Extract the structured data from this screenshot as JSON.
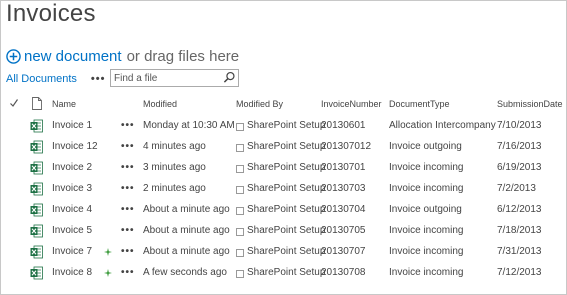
{
  "header": {
    "title": "Invoices"
  },
  "actions": {
    "new_document_label": "new document",
    "or_drag_label": "or drag files here"
  },
  "toolbar": {
    "view_label": "All Documents",
    "more_label": "•••",
    "search_placeholder": "Find a file"
  },
  "columns": [
    "Name",
    "Modified",
    "Modified By",
    "InvoiceNumber",
    "DocumentType",
    "SubmissionDate"
  ],
  "rows": [
    {
      "name": "Invoice 1",
      "is_new": false,
      "modified": "Monday at 10:30 AM",
      "modified_by": "SharePoint Setup",
      "invoice_number": "20130601",
      "document_type": "Allocation Intercompany",
      "submission_date": "7/10/2013"
    },
    {
      "name": "Invoice 12",
      "is_new": false,
      "modified": "4 minutes ago",
      "modified_by": "SharePoint Setup",
      "invoice_number": "201307012",
      "document_type": "Invoice outgoing",
      "submission_date": "7/16/2013"
    },
    {
      "name": "Invoice 2",
      "is_new": false,
      "modified": "3 minutes ago",
      "modified_by": "SharePoint Setup",
      "invoice_number": "20130701",
      "document_type": "Invoice incoming",
      "submission_date": "6/19/2013"
    },
    {
      "name": "Invoice 3",
      "is_new": false,
      "modified": "2 minutes ago",
      "modified_by": "SharePoint Setup",
      "invoice_number": "20130703",
      "document_type": "Invoice incoming",
      "submission_date": "7/2/2013"
    },
    {
      "name": "Invoice 4",
      "is_new": false,
      "modified": "About a minute ago",
      "modified_by": "SharePoint Setup",
      "invoice_number": "20130704",
      "document_type": "Invoice outgoing",
      "submission_date": "6/12/2013"
    },
    {
      "name": "Invoice 5",
      "is_new": false,
      "modified": "About a minute ago",
      "modified_by": "SharePoint Setup",
      "invoice_number": "20130705",
      "document_type": "Invoice incoming",
      "submission_date": "7/18/2013"
    },
    {
      "name": "Invoice 7",
      "is_new": true,
      "modified": "About a minute ago",
      "modified_by": "SharePoint Setup",
      "invoice_number": "20130707",
      "document_type": "Invoice incoming",
      "submission_date": "7/31/2013"
    },
    {
      "name": "Invoice 8",
      "is_new": true,
      "modified": "A few seconds ago",
      "modified_by": "SharePoint Setup",
      "invoice_number": "20130708",
      "document_type": "Invoice incoming",
      "submission_date": "7/12/2013"
    }
  ],
  "row_more_label": "•••",
  "icons": {
    "add": "plus-circle-icon",
    "search": "magnifier-icon",
    "select_all": "checkmark-icon",
    "doc_type": "document-icon",
    "file": "excel-file-icon",
    "new_item": "new-sparkle-icon",
    "person_presence": "presence-box-icon"
  },
  "colors": {
    "link": "#0072c6",
    "text": "#444444",
    "excel_green": "#1e7145",
    "new_green": "#3a9a3a"
  }
}
